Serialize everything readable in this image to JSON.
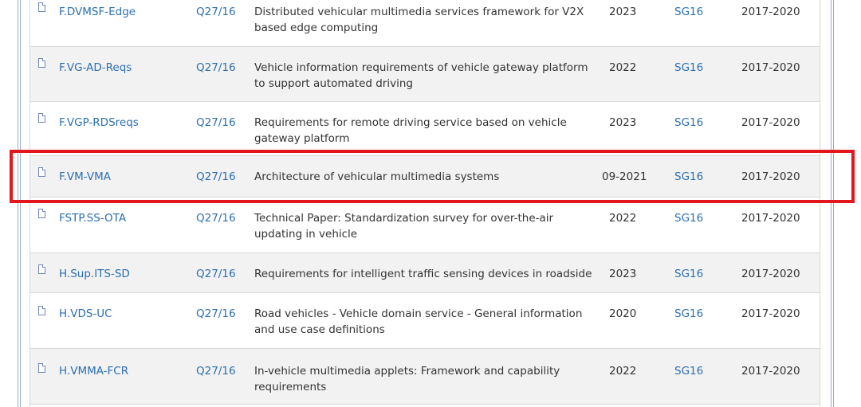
{
  "rows": [
    {
      "name": "F.DVMSF-Edge",
      "question": "Q27/16",
      "title": "Distributed vehicular multimedia services framework for V2X based edge computing",
      "date": "2023",
      "group": "SG16",
      "period": "2017-2020"
    },
    {
      "name": "F.VG-AD-Reqs",
      "question": "Q27/16",
      "title": "Vehicle information requirements of vehicle gateway platform to support automated driving",
      "date": "2022",
      "group": "SG16",
      "period": "2017-2020"
    },
    {
      "name": "F.VGP-RDSreqs",
      "question": "Q27/16",
      "title": "Requirements for remote driving service based on vehicle gateway platform",
      "date": "2023",
      "group": "SG16",
      "period": "2017-2020"
    },
    {
      "name": "F.VM-VMA",
      "question": "Q27/16",
      "title": "Architecture of vehicular multimedia systems",
      "date": "09-2021",
      "group": "SG16",
      "period": "2017-2020"
    },
    {
      "name": "FSTP.SS-OTA",
      "question": "Q27/16",
      "title": "Technical Paper: Standardization survey for over-the-air updating in vehicle",
      "date": "2022",
      "group": "SG16",
      "period": "2017-2020"
    },
    {
      "name": "H.Sup.ITS-SD",
      "question": "Q27/16",
      "title": "Requirements for intelligent traffic sensing devices in roadside",
      "date": "2023",
      "group": "SG16",
      "period": "2017-2020"
    },
    {
      "name": "H.VDS-UC",
      "question": "Q27/16",
      "title": "Road vehicles - Vehicle domain service - General information and use case definitions",
      "date": "2020",
      "group": "SG16",
      "period": "2017-2020"
    },
    {
      "name": "H.VMMA-FCR",
      "question": "Q27/16",
      "title": "In-vehicle multimedia applets: Framework and capability requirements",
      "date": "2022",
      "group": "SG16",
      "period": "2017-2020"
    }
  ],
  "icon": "document-icon",
  "colors": {
    "link": "#2b6fb0",
    "text": "#333333",
    "row_alt": "#f2f2f2",
    "highlight": "#e3161e"
  }
}
